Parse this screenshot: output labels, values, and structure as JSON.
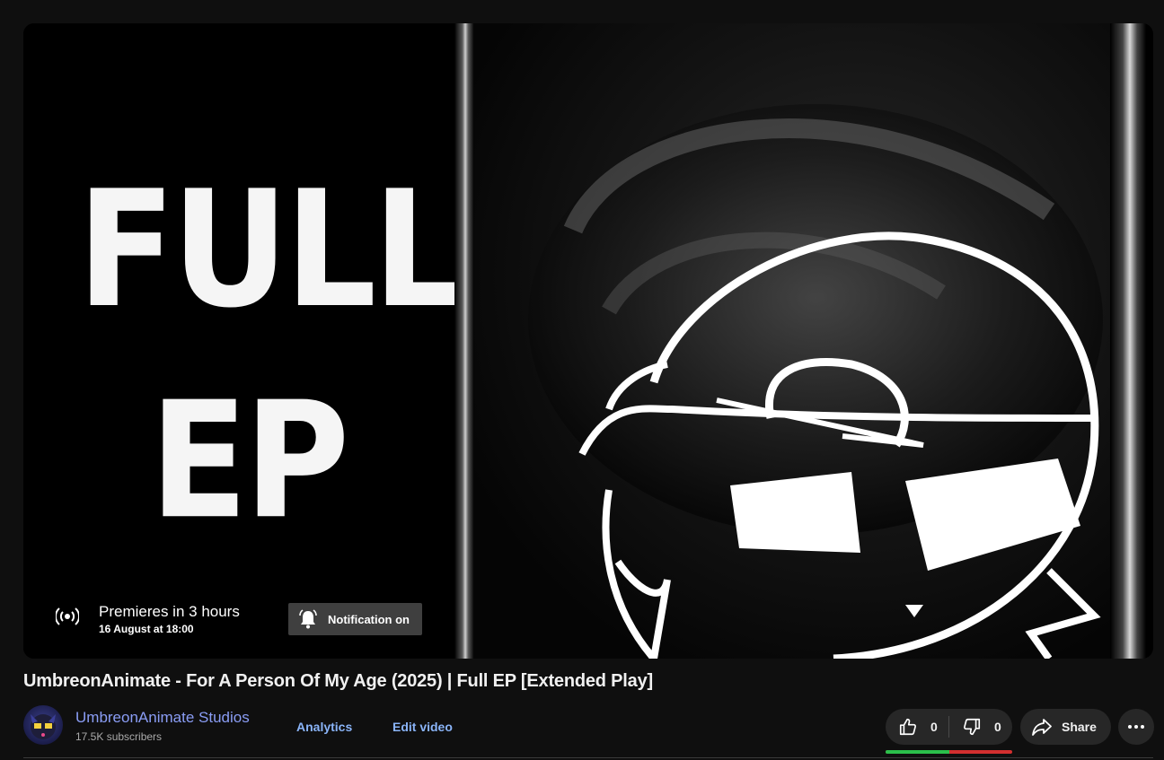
{
  "player": {
    "thumbnail_text_line1": "FULL",
    "thumbnail_text_line2": "EP",
    "premiere_title": "Premieres in 3 hours",
    "premiere_date": "16 August at 18:00",
    "notification_label": "Notification on"
  },
  "video": {
    "title": "UmbreonAnimate - For A Person Of My Age (2025) | Full EP [Extended Play]"
  },
  "owner": {
    "channel_name": "UmbreonAnimate Studios",
    "subscribers": "17.5K subscribers",
    "analytics_label": "Analytics",
    "edit_label": "Edit video"
  },
  "actions": {
    "like_count": "0",
    "dislike_count": "0",
    "like_ratio": 0.5,
    "share_label": "Share"
  },
  "colors": {
    "background": "#0f0f0f",
    "pill": "#272727",
    "link": "#8ab4f8",
    "channel": "#8a9df5",
    "like_bar": "#2bbf4b",
    "dislike_bar": "#d32f2f"
  },
  "icons": [
    "broadcast-icon",
    "bell-ring-icon",
    "thumbs-up-icon",
    "thumbs-down-icon",
    "share-arrow-icon",
    "more-horizontal-icon"
  ]
}
